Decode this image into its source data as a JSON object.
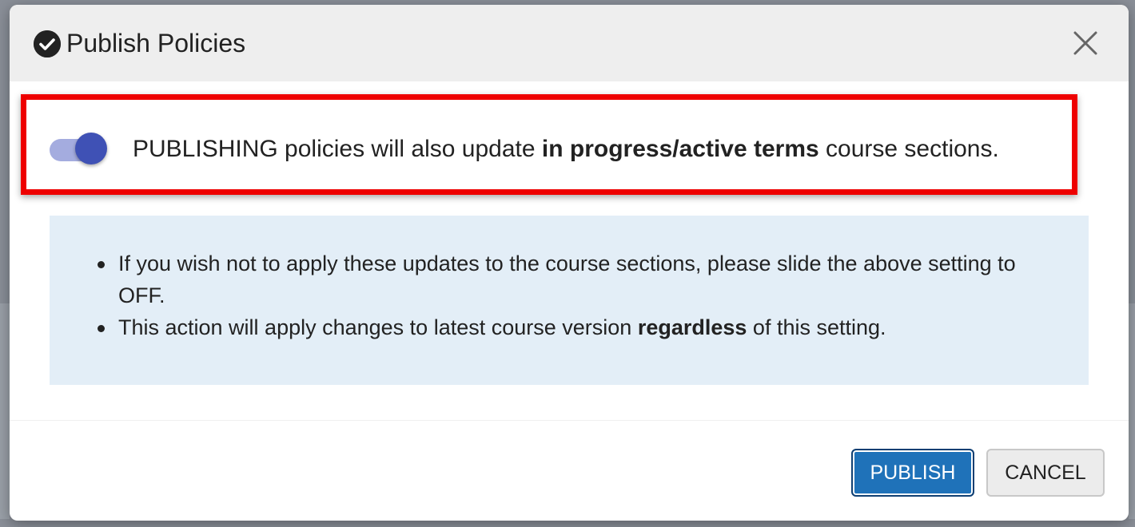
{
  "modal": {
    "title": "Publish Policies",
    "title_icon": "check-circle-icon",
    "close_icon": "close-icon"
  },
  "toggle": {
    "state": "on",
    "text_before": "PUBLISHING policies will also update ",
    "text_bold": "in progress/active terms",
    "text_after": " course sections."
  },
  "info": {
    "items": [
      {
        "text_before": "If you wish not to apply these updates to the course sections, please slide the above setting to OFF.",
        "text_bold": "",
        "text_after": ""
      },
      {
        "text_before": "This action will apply changes to latest course version ",
        "text_bold": "regardless",
        "text_after": " of this setting."
      }
    ]
  },
  "buttons": {
    "publish_label": "PUBLISH",
    "cancel_label": "CANCEL"
  },
  "colors": {
    "highlight_border": "#ee0000",
    "toggle_thumb": "#3f51b5",
    "toggle_track": "#a4acdf",
    "info_background": "#e3eef7",
    "primary_button": "#1f72b9",
    "header_background": "#eeeeee"
  }
}
